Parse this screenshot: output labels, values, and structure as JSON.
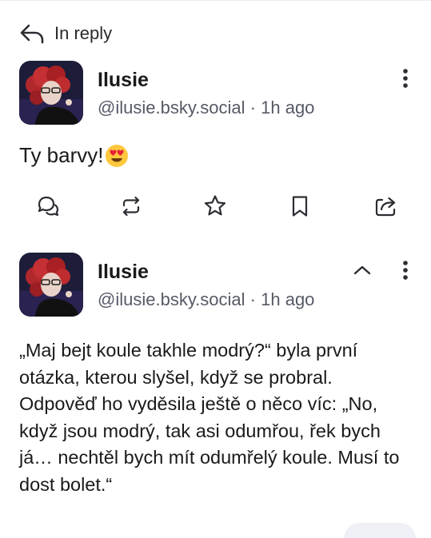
{
  "header": {
    "reply_label": "In reply"
  },
  "posts": [
    {
      "author": "Ilusie",
      "handle": "@ilusie.bsky.social",
      "separator": "·",
      "time": "1h ago",
      "text": "Ty barvy!",
      "emoji": "smiling-face-with-heart-eyes",
      "actions": [
        "reply-icon",
        "repost-icon",
        "star-icon",
        "bookmark-icon",
        "share-icon"
      ]
    },
    {
      "author": "Ilusie",
      "handle": "@ilusie.bsky.social",
      "separator": "·",
      "time": "1h ago",
      "paragraphs": [
        "„Maj bejt koule takhle modrý?“ byla první otázka, kterou slyšel, když se probral.",
        "Odpověď ho vyděsila ještě o něco víc: „No, když jsou modrý, tak asi odumřou, řek bych já… nechtěl bych mít odumřelý koule. Musí to dost bolet.“"
      ]
    }
  ],
  "colors": {
    "text": "#1a1a1a",
    "secondary_text": "#555a66",
    "icon": "#2b2d33"
  }
}
